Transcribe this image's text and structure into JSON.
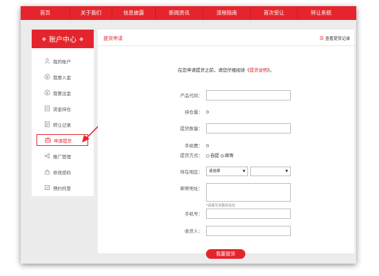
{
  "nav": {
    "items": [
      "首页",
      "关于我们",
      "信息披露",
      "新闻资讯",
      "流程指南",
      "首次受让",
      "转让系统"
    ]
  },
  "sidebar": {
    "title": "账户中心",
    "items": [
      {
        "label": "我的账户",
        "icon": "user-icon"
      },
      {
        "label": "我要入金",
        "icon": "deposit-icon"
      },
      {
        "label": "我要出金",
        "icon": "withdraw-icon"
      },
      {
        "label": "资金持仓",
        "icon": "holdings-icon"
      },
      {
        "label": "转让记录",
        "icon": "record-icon"
      },
      {
        "label": "申请提货",
        "icon": "briefcase-icon",
        "active": true
      },
      {
        "label": "推广管理",
        "icon": "share-icon"
      },
      {
        "label": "修改密码",
        "icon": "lock-icon"
      },
      {
        "label": "预约托管",
        "icon": "calendar-edit-icon"
      }
    ]
  },
  "main": {
    "title": "提货申请",
    "record_link": "查看提货记录",
    "notice_prefix": "在您申请提货之前，请您仔细阅读《",
    "notice_link": "提货说明",
    "notice_suffix": "》。",
    "form": {
      "product_code_label": "产品代码：",
      "holding_label": "持仓量：",
      "holding_value": "0",
      "quantity_label": "提货数量：",
      "fee_label": "手续费：",
      "fee_value": "0",
      "method_label": "提货方式：",
      "method_options": [
        "自提",
        "邮寄"
      ],
      "region_label": "所在地区：",
      "region_placeholder": "请选择",
      "address_label": "邮寄地址：",
      "address_hint": "*请填写完整的信息",
      "phone_label": "手机号：",
      "receiver_label": "收货人："
    },
    "submit_label": "我要提货"
  },
  "colors": {
    "accent": "#e5252d"
  }
}
